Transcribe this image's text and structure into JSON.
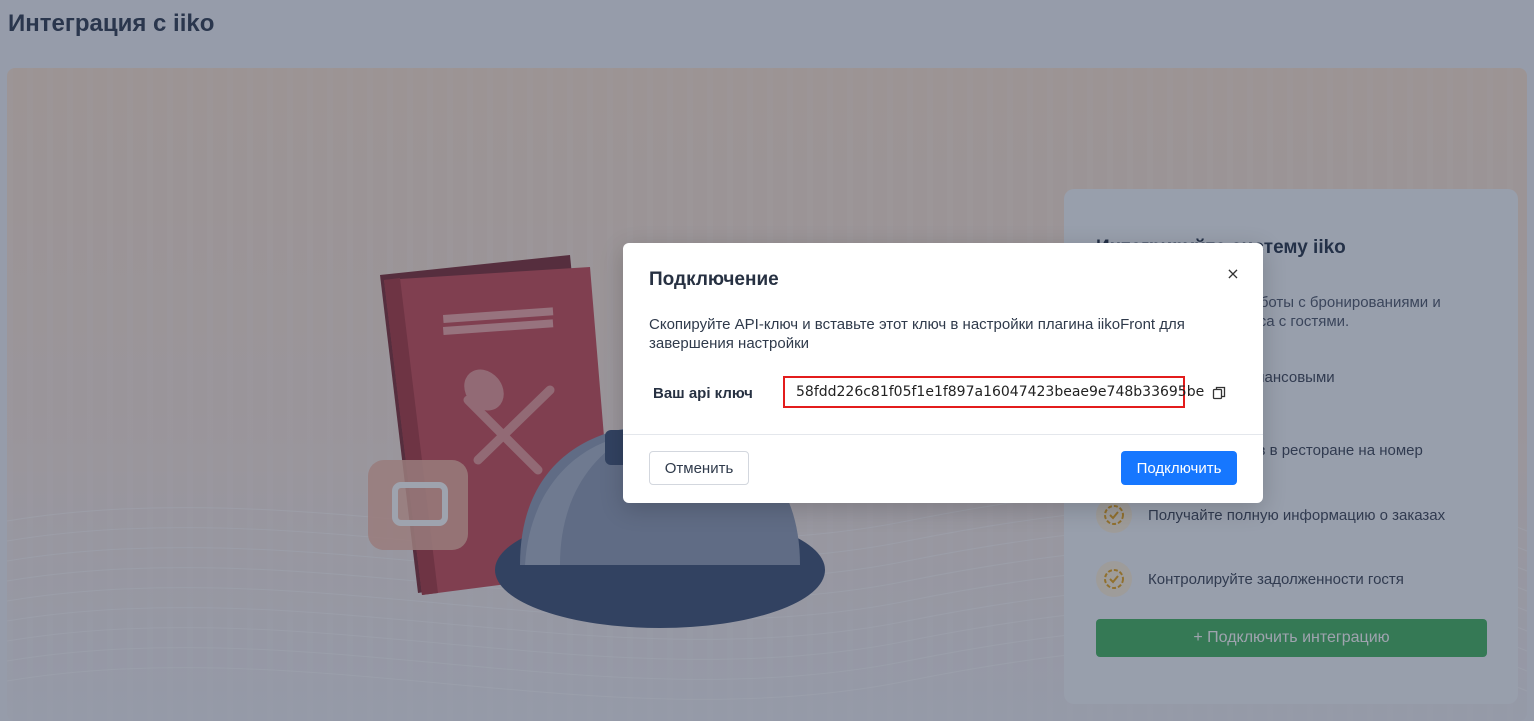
{
  "page": {
    "title": "Интеграция с iiko"
  },
  "side_card": {
    "title": "Интегрируйте систему iiko",
    "description": "Упростите процессы работы с бронированиями и персонализацию сервиса с гостями.",
    "features": [
      "Управление финансовыми",
      "Перенос заказов в ресторане на номер",
      "Получайте полную информацию о заказах",
      "Контролируйте задолженности гостя"
    ],
    "button_label": "+ Подключить интеграцию"
  },
  "modal": {
    "title": "Подключение",
    "close_label": "×",
    "description": "Скопируйте API-ключ и вставьте этот ключ в настройки плагина iikoFront для завершения настройки",
    "key_label": "Ваш api ключ",
    "key_value": "58fdd226c81f05f1e1f897a16047423beae9e748b33695be",
    "cancel_label": "Отменить",
    "connect_label": "Подключить"
  },
  "colors": {
    "primary": "#1677ff",
    "success": "#41b35d",
    "highlight_border": "#e31c1c"
  }
}
